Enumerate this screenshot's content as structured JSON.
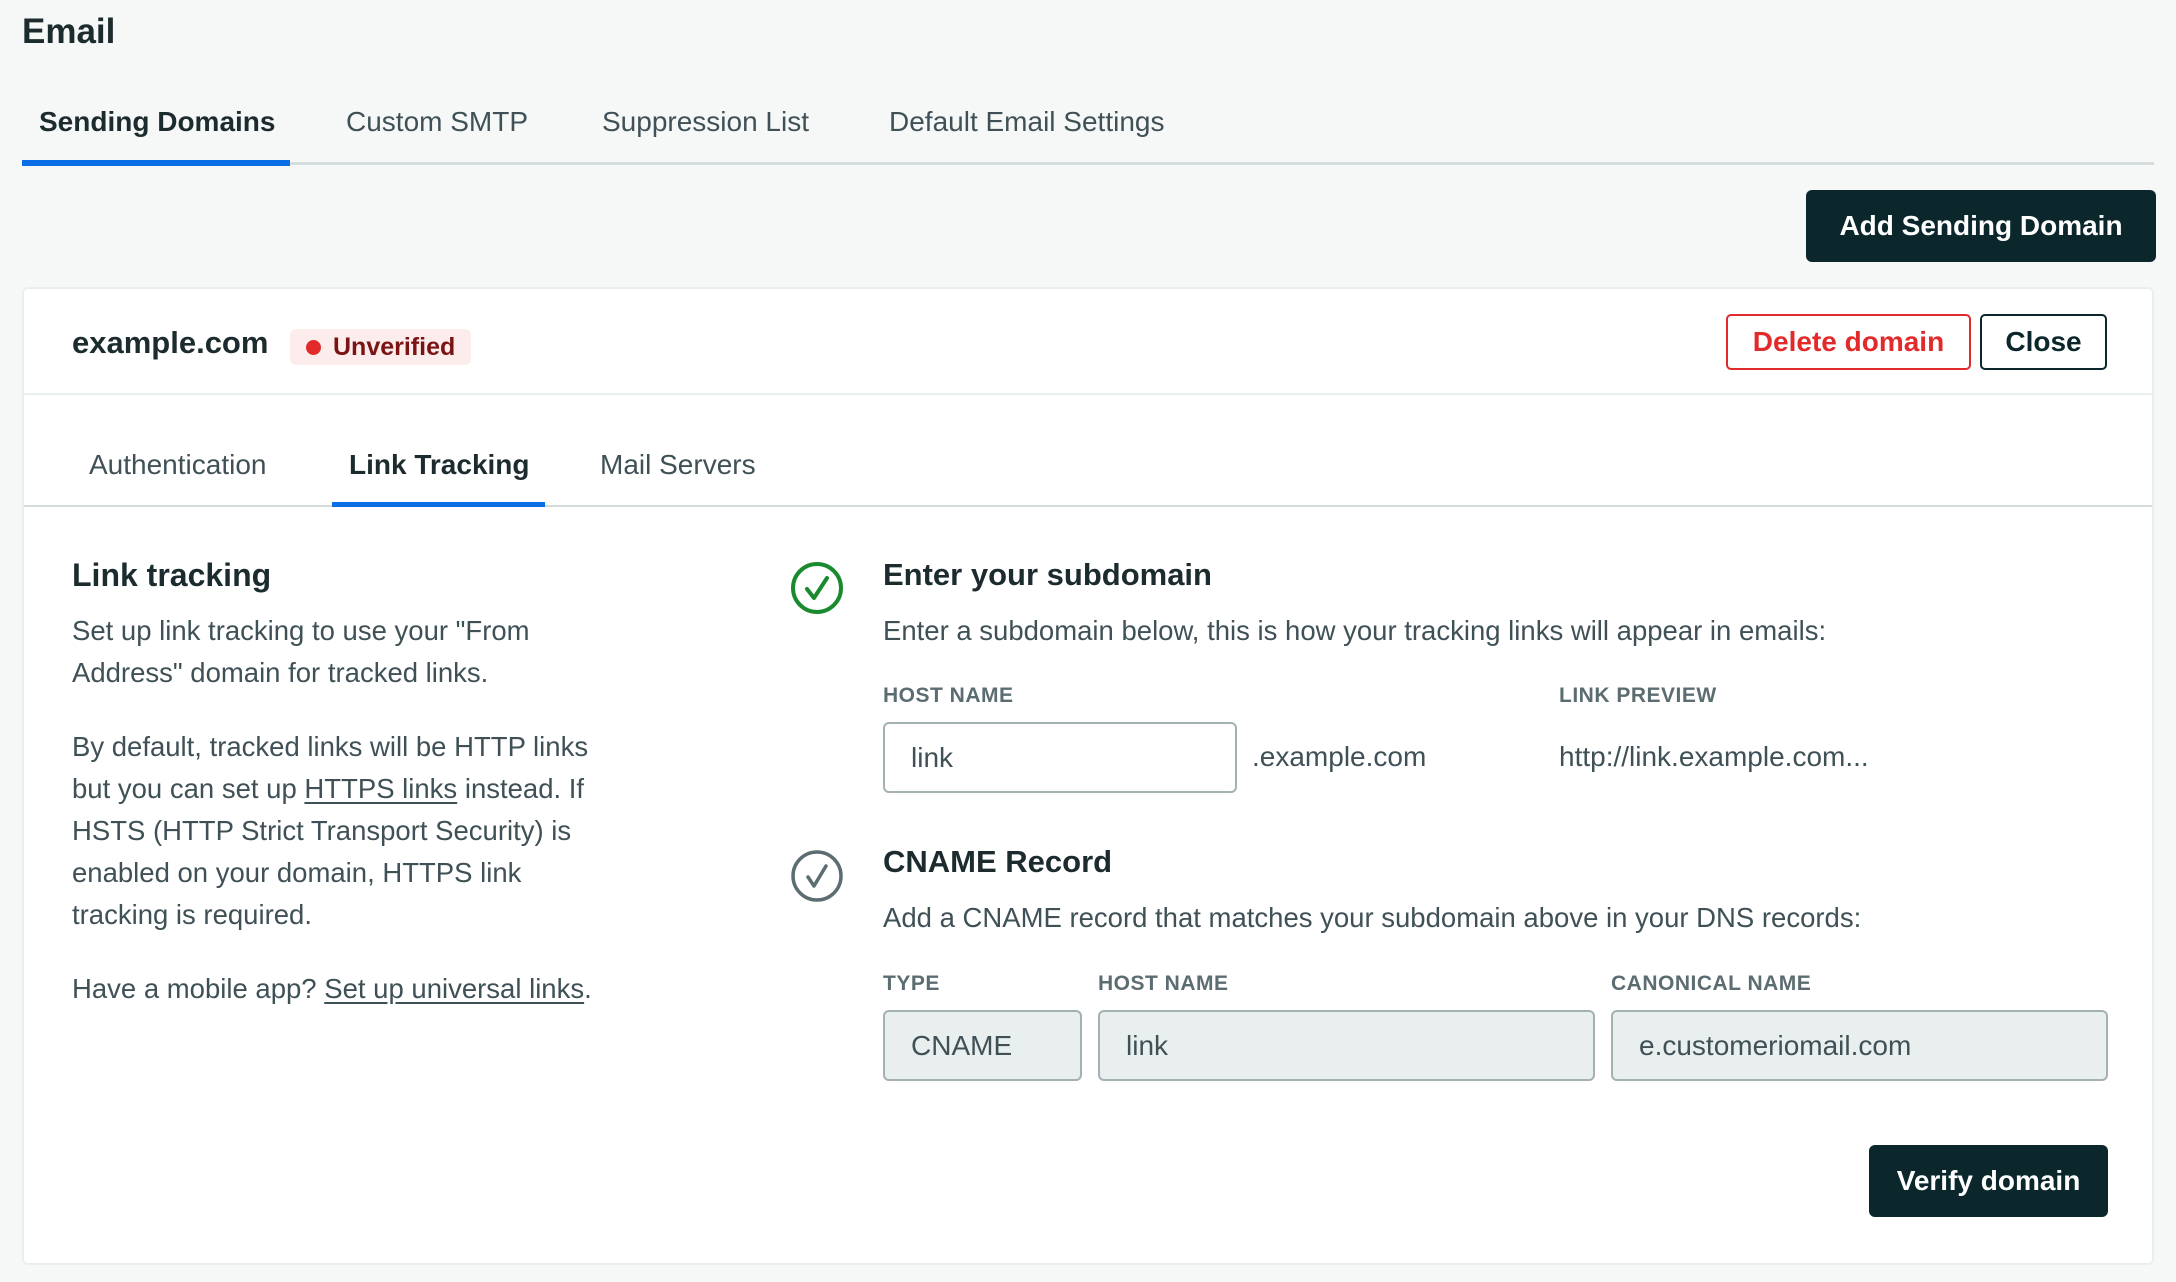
{
  "page": {
    "title": "Email",
    "tabs": [
      {
        "label": "Sending Domains",
        "active": true
      },
      {
        "label": "Custom SMTP",
        "active": false
      },
      {
        "label": "Suppression List",
        "active": false
      },
      {
        "label": "Default Email Settings",
        "active": false
      }
    ],
    "add_domain_label": "Add Sending Domain"
  },
  "domain_card": {
    "domain": "example.com",
    "status": {
      "label": "Unverified",
      "color": "#e22a2a"
    },
    "delete_label": "Delete domain",
    "close_label": "Close",
    "tabs": [
      {
        "label": "Authentication",
        "active": false
      },
      {
        "label": "Link Tracking",
        "active": true
      },
      {
        "label": "Mail Servers",
        "active": false
      }
    ]
  },
  "link_tracking": {
    "heading": "Link tracking",
    "para1": "Set up link tracking to use your \"From Address\" domain for tracked links.",
    "para2_before": "By default, tracked links will be HTTP links but you can set up ",
    "para2_link": "HTTPS links",
    "para2_after": " instead. If HSTS (HTTP Strict Transport Security) is enabled on your domain, HTTPS link tracking is required.",
    "para3_before": "Have a mobile app? ",
    "para3_link": "Set up universal links",
    "para3_after": "."
  },
  "subdomain_step": {
    "status": "complete",
    "status_color": "#1a8a2e",
    "heading": "Enter your subdomain",
    "description": "Enter a subdomain below, this is how your tracking links will appear in emails:",
    "host_label": "HOST NAME",
    "host_value": "link",
    "suffix": ".example.com",
    "preview_label": "LINK PREVIEW",
    "preview_value": "http://link.example.com..."
  },
  "cname_step": {
    "status": "pending",
    "status_color": "#5c6d71",
    "heading": "CNAME Record",
    "description": "Add a CNAME record that matches your subdomain above in your DNS records:",
    "type_label": "TYPE",
    "type_value": "CNAME",
    "host_label": "HOST NAME",
    "host_value": "link",
    "canonical_label": "CANONICAL NAME",
    "canonical_value": "e.customeriomail.com"
  },
  "verify_label": "Verify domain"
}
